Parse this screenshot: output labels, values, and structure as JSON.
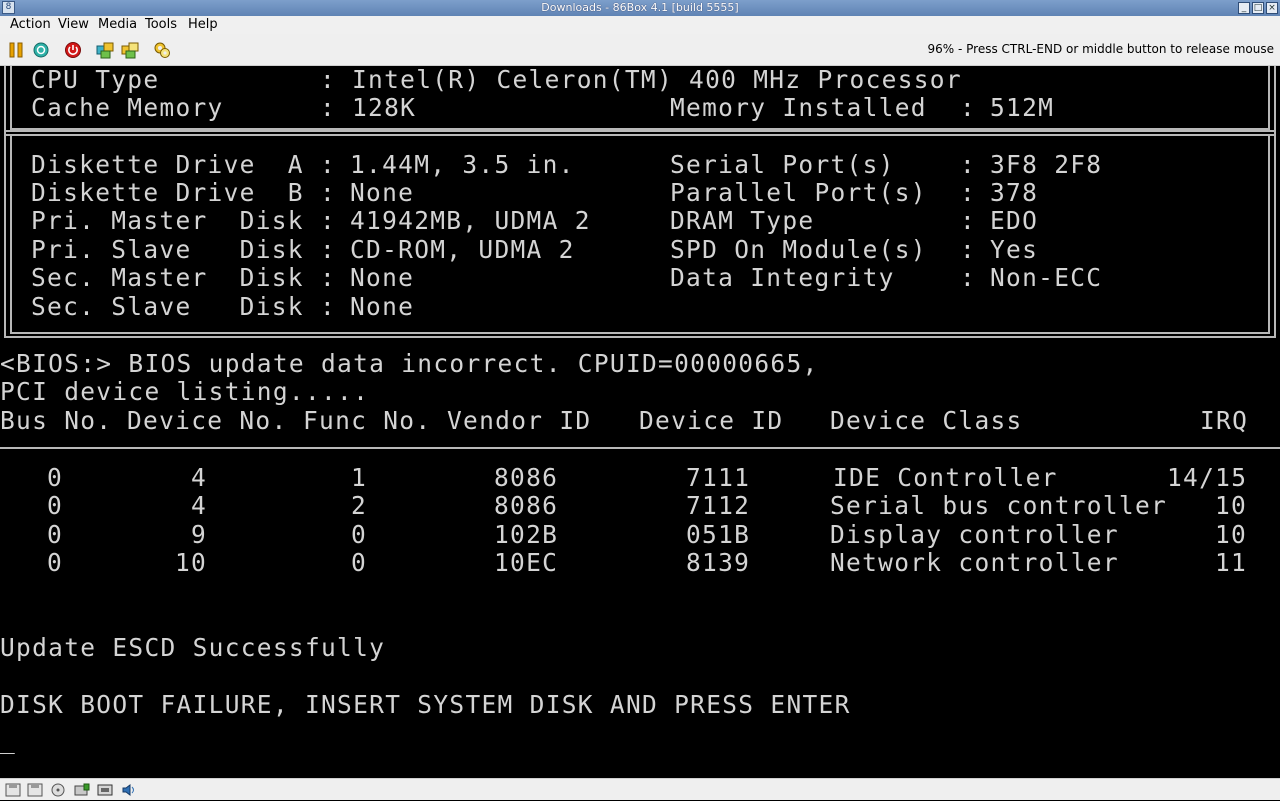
{
  "window": {
    "title": "Downloads - 86Box 4.1 [build 5555]"
  },
  "menu": [
    {
      "label": "Action"
    },
    {
      "label": "View"
    },
    {
      "label": "Media"
    },
    {
      "label": "Tools"
    },
    {
      "label": "Help"
    }
  ],
  "toolbar": {
    "icons": [
      "pause-icon",
      "reset-icon",
      "power-icon",
      "ctrl-alt-del-icon",
      "ctrl-alt-esc-icon",
      "settings-icon"
    ],
    "status_message": "96% - Press CTRL-END or middle button to release mouse"
  },
  "bios": {
    "cpu_label": "CPU Type",
    "cpu_value": "Intel(R) Celeron(TM) 400 MHz Processor",
    "cache_label": "Cache Memory",
    "cache_value": "128K",
    "mem_label": "Memory Installed",
    "mem_value": "512M",
    "left_rows": [
      {
        "label": "Diskette Drive  A",
        "value": "1.44M, 3.5 in."
      },
      {
        "label": "Diskette Drive  B",
        "value": "None"
      },
      {
        "label": "Pri. Master  Disk",
        "value": "41942MB, UDMA 2"
      },
      {
        "label": "Pri. Slave   Disk",
        "value": "CD-ROM, UDMA 2"
      },
      {
        "label": "Sec. Master  Disk",
        "value": "None"
      },
      {
        "label": "Sec. Slave   Disk",
        "value": "None"
      }
    ],
    "right_rows": [
      {
        "label": "Serial Port(s)",
        "value": "3F8 2F8"
      },
      {
        "label": "Parallel Port(s)",
        "value": "378"
      },
      {
        "label": "DRAM Type",
        "value": "EDO"
      },
      {
        "label": "SPD On Module(s)",
        "value": "Yes"
      },
      {
        "label": "Data Integrity",
        "value": "Non-ECC"
      }
    ],
    "separator": ":",
    "msg_bios": "<BIOS:> BIOS update data incorrect. CPUID=00000665,",
    "msg_pci": "PCI device listing.....",
    "pci_headers": [
      "Bus No.",
      "Device No.",
      "Func No.",
      "Vendor ID",
      "Device ID",
      "Device Class",
      "IRQ"
    ],
    "pci_rows": [
      {
        "bus": "0",
        "device": "4",
        "func": "1",
        "vendor": "8086",
        "devid": "7111",
        "class": "IDE Controller",
        "irq": "14/15"
      },
      {
        "bus": "0",
        "device": "4",
        "func": "2",
        "vendor": "8086",
        "devid": "7112",
        "class": "Serial bus controller",
        "irq": "10"
      },
      {
        "bus": "0",
        "device": "9",
        "func": "0",
        "vendor": "102B",
        "devid": "051B",
        "class": "Display controller",
        "irq": "10"
      },
      {
        "bus": "0",
        "device": "10",
        "func": "0",
        "vendor": "10EC",
        "devid": "8139",
        "class": "Network controller",
        "irq": "11"
      }
    ],
    "msg_escd": "Update ESCD Successfully",
    "msg_boot": "DISK BOOT FAILURE, INSERT SYSTEM DISK AND PRESS ENTER",
    "cursor": "_"
  },
  "statusbar": {
    "icons": [
      "floppy-a-icon",
      "floppy-b-icon",
      "cdrom-icon",
      "hard-disk-icon",
      "network-icon",
      "sound-icon"
    ]
  }
}
